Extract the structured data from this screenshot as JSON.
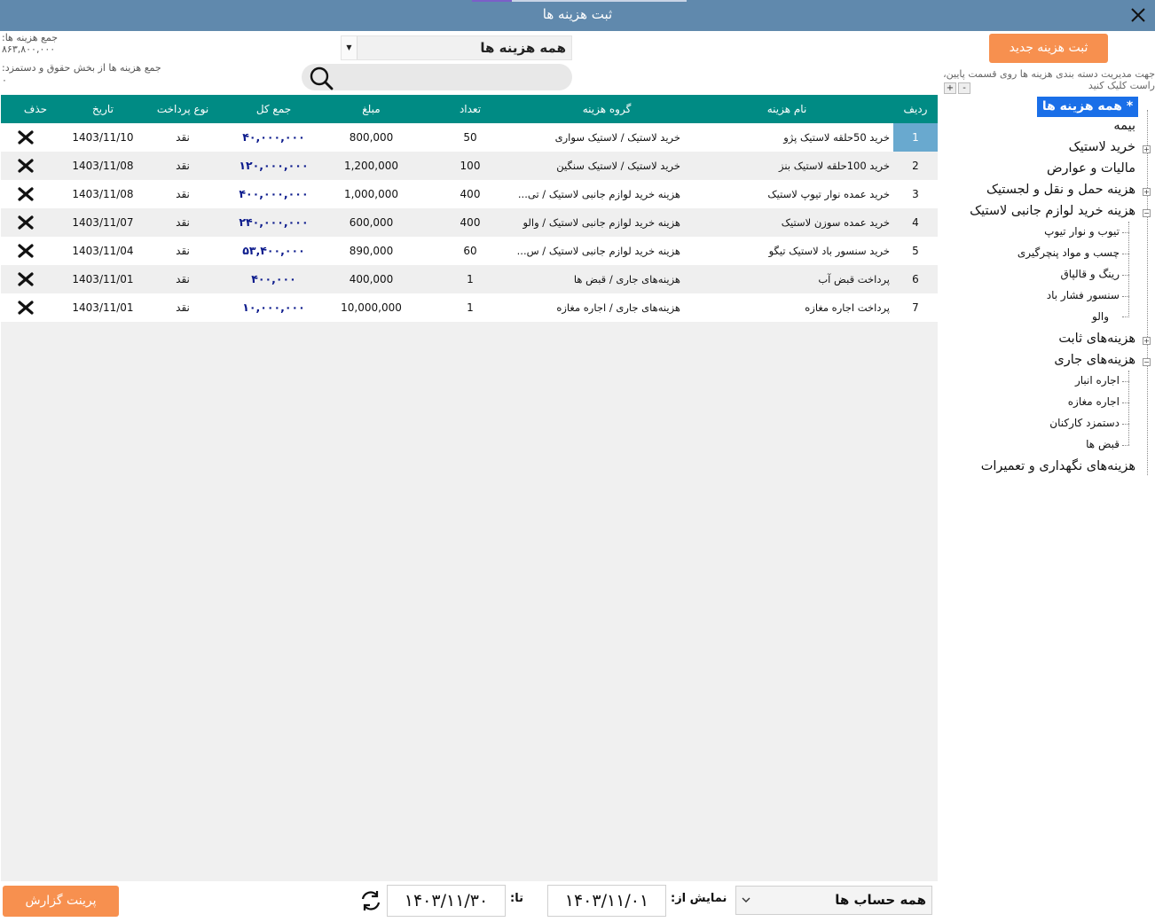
{
  "window": {
    "title": "ثبت هزینه ها"
  },
  "summary": {
    "total_label": "جمع هزینه ها:",
    "total_value": "۸۶۳,۸۰۰,۰۰۰",
    "salary_label": "جمع هزینه ها از بخش حقوق و دستمزد:",
    "salary_value": "۰"
  },
  "filter": {
    "selected": "همه هزینه ها"
  },
  "grid": {
    "headers": {
      "idx": "ردیف",
      "name": "نام هزینه",
      "group": "گروه هزینه",
      "qty": "تعداد",
      "amount": "مبلغ",
      "total": "جمع کل",
      "payment": "نوع پرداخت",
      "date": "تاریخ",
      "delete": "حذف"
    },
    "rows": [
      {
        "idx": "1",
        "name": "خرید 50حلقه لاستیک پژو",
        "group": "خرید لاستیک  / لاستیک سواری",
        "qty": "50",
        "amount": "800,000",
        "total": "۴۰,۰۰۰,۰۰۰",
        "payment": "نقد",
        "date": "1403/11/10"
      },
      {
        "idx": "2",
        "name": "خرید 100حلقه لاستیک بنز",
        "group": "خرید لاستیک  / لاستیک سنگین",
        "qty": "100",
        "amount": "1,200,000",
        "total": "۱۲۰,۰۰۰,۰۰۰",
        "payment": "نقد",
        "date": "1403/11/08"
      },
      {
        "idx": "3",
        "name": "خرید عمده نوار تیوپ لاستیک",
        "group": "هزینه خرید لوازم جانبی لاستیک / تی...",
        "qty": "400",
        "amount": "1,000,000",
        "total": "۴۰۰,۰۰۰,۰۰۰",
        "payment": "نقد",
        "date": "1403/11/08"
      },
      {
        "idx": "4",
        "name": "خرید عمده سوزن لاستیک",
        "group": "هزینه خرید لوازم جانبی لاستیک / والو",
        "qty": "400",
        "amount": "600,000",
        "total": "۲۴۰,۰۰۰,۰۰۰",
        "payment": "نقد",
        "date": "1403/11/07"
      },
      {
        "idx": "5",
        "name": "خرید سنسور باد لاستیک تیگو",
        "group": "هزینه خرید لوازم جانبی لاستیک / س...",
        "qty": "60",
        "amount": "890,000",
        "total": "۵۳,۴۰۰,۰۰۰",
        "payment": "نقد",
        "date": "1403/11/04"
      },
      {
        "idx": "6",
        "name": "پرداخت قبض آب",
        "group": "هزینه‌های جاری / قبض ها",
        "qty": "1",
        "amount": "400,000",
        "total": "۴۰۰,۰۰۰",
        "payment": "نقد",
        "date": "1403/11/01"
      },
      {
        "idx": "7",
        "name": "پرداخت اجاره مغازه",
        "group": "هزینه‌های جاری / اجاره مغازه",
        "qty": "1",
        "amount": "10,000,000",
        "total": "۱۰,۰۰۰,۰۰۰",
        "payment": "نقد",
        "date": "1403/11/01"
      }
    ]
  },
  "sidebar": {
    "new_button": "ثبت هزینه جدید",
    "hint": "جهت مدیریت دسته بندی هزینه ها روی قسمت پایین، راست کلیک کنید",
    "plus": "+",
    "minus": "-",
    "tree_selected": "* همه هزینه ها *",
    "tree": [
      {
        "label": "بیمه"
      },
      {
        "label": "خرید لاستیک"
      },
      {
        "label": "مالیات و عوارض"
      },
      {
        "label": "هزینه حمل و نقل و لجستیک"
      },
      {
        "label": "هزینه خرید لوازم جانبی لاستیک"
      },
      {
        "label": "هزینه‌های ثابت"
      },
      {
        "label": "هزینه‌های جاری"
      },
      {
        "label": "هزینه‌های نگهداری و تعمیرات"
      }
    ],
    "accessories_children": [
      "تیوب و نوار تیوپ",
      "چسب و مواد پنچرگیری",
      "رینگ و قالپاق",
      "سنسور فشار باد",
      "والو"
    ],
    "current_children": [
      "اجاره انبار",
      "اجاره مغازه",
      "دستمزد کارکنان",
      "قبض ها"
    ]
  },
  "footer": {
    "print_button": "پرینت گزارش",
    "to_label": "تا:",
    "to_date": "۱۴۰۳/۱۱/۳۰",
    "from_label": "نمایش از:",
    "from_date": "۱۴۰۳/۱۱/۰۱",
    "account_selected": "همه حساب ها"
  }
}
